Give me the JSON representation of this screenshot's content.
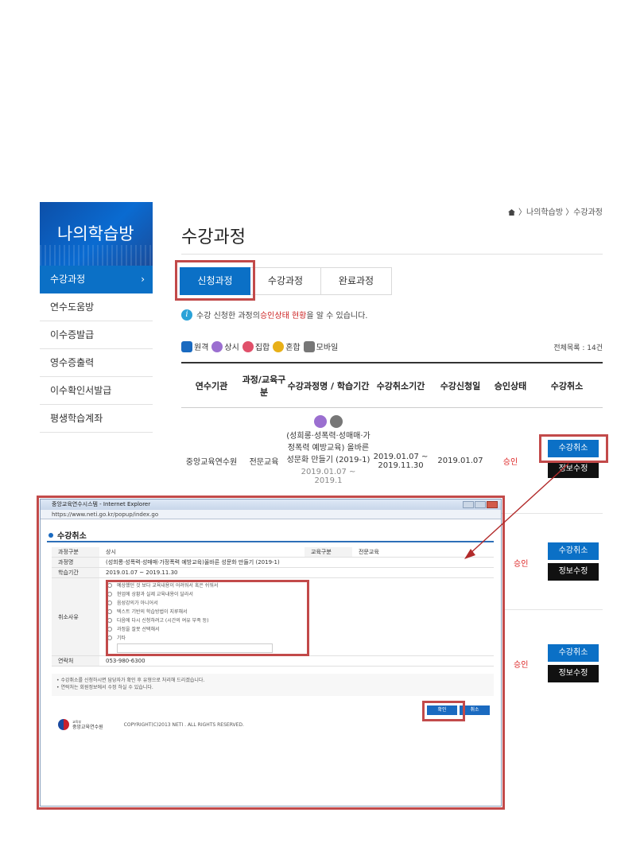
{
  "sidebar": {
    "banner": "나의학습방",
    "items": [
      {
        "label": "수강과정"
      },
      {
        "label": "연수도움방"
      },
      {
        "label": "이수증발급"
      },
      {
        "label": "영수증출력"
      },
      {
        "label": "이수확인서발급"
      },
      {
        "label": "평생학습계좌"
      }
    ],
    "chevron": "›"
  },
  "breadcrumb": "〉나의학습방 〉수강과정",
  "page_title": "수강과정",
  "tabs": [
    "신청과정",
    "수강과정",
    "완료과정"
  ],
  "info": {
    "pre": "수강 신청한 과정의 ",
    "highlight": "승인상태 현황",
    "post": "을 알 수 있습니다.",
    "icon": "i"
  },
  "legend": [
    {
      "label": "원격",
      "color": "#1a6ac0"
    },
    {
      "label": "상시",
      "color": "#9b6fd0"
    },
    {
      "label": "집합",
      "color": "#e0506a"
    },
    {
      "label": "혼합",
      "color": "#e8b018"
    },
    {
      "label": "모바일",
      "color": "#777777"
    }
  ],
  "total": "전체목록 : 14건",
  "table": {
    "headers": [
      "연수기관",
      "과정/교육구분",
      "수강과정명 / 학습기간",
      "수강취소기간",
      "수강신청일",
      "승인상태",
      "수강취소"
    ],
    "row": {
      "institution": "중앙교육연수원",
      "category": "전문교육",
      "course_name": "(성희롱·성폭력·성매매·가정폭력 예방교육) 올바른 성문화 만들기 (2019-1)",
      "period": "2019.01.07 ~ 2019.1",
      "cancel_period": "2019.01.07 ~ 2019.11.30",
      "apply_date": "2019.01.07",
      "status": "승인"
    },
    "status_2": "승인",
    "status_3": "승인",
    "cancel_label": "수강취소",
    "edit_label": "정보수정"
  },
  "popup": {
    "window_title": "중앙교육연수시스템 - Internet Explorer",
    "address": "https://www.neti.go.kr/popup/index.go",
    "heading": "수강취소",
    "fields": {
      "type_label": "과정구분",
      "type_value": "상시",
      "edu_label": "교육구분",
      "edu_value": "전문교육",
      "name_label": "과정명",
      "name_value": "(성희롱·성폭력·성매매·가정폭력 예방교육)올바른 성문화 만들기 (2019-1)",
      "period_label": "학습기간",
      "period_value": "2019.01.07 ~ 2019.11.30",
      "reason_label": "취소사유",
      "contact_label": "연락처",
      "contact_value": "053-980-6300"
    },
    "reasons": [
      "예상했던 것 보다 교육내용이 어려워서 혹은 쉬워서",
      "현업에 상황과 실제 교육내용이 달라서",
      "음성강의가 아니어서",
      "텍스트 기반의 학습방법이 지루해서",
      "다음에 다시 신청하려고 (시간의 여유 부족 등)",
      "과정을 잘못 선택해서",
      "기타"
    ],
    "notes": [
      "• 수강취소를 신청하시면 담당자가 확인 후 유형으로 처리해 드리겠습니다.",
      "• 연락처는 회원정보에서 수정 하실 수 있습니다."
    ],
    "btn_confirm": "확인",
    "btn_cancel": "취소",
    "org": "중앙교육연수원",
    "org_top": "교육부",
    "copyright": "COPYRIGHT(C)2013 NETI . ALL RIGHTS RESERVED."
  }
}
